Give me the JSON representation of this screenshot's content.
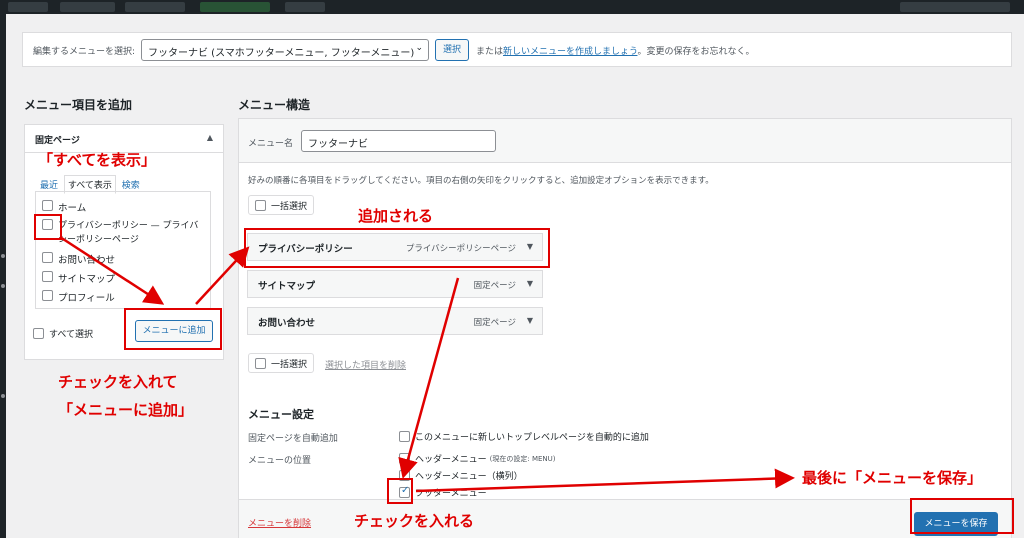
{
  "select_bar": {
    "label": "編集するメニューを選択:",
    "selected_menu": "フッターナビ (スマホフッターメニュー, フッターメニュー)",
    "select_button": "選択",
    "text_or": "または",
    "create_link": "新しいメニューを作成しましょう",
    "text_suffix": "。変更の保存をお忘れなく。"
  },
  "left": {
    "heading": "メニュー項目を追加",
    "panel_title": "固定ページ",
    "tabs": [
      "最近",
      "すべて表示",
      "検索"
    ],
    "pages": [
      "ホーム",
      "プライバシーポリシー — プライバシーポリシーページ",
      "お問い合わせ",
      "サイトマップ",
      "プロフィール"
    ],
    "select_all": "すべて選択",
    "add_button": "メニューに追加"
  },
  "right": {
    "heading": "メニュー構造",
    "name_label": "メニュー名",
    "name_value": "フッターナビ",
    "instructions": "好みの順番に各項目をドラッグしてください。項目の右側の矢印をクリックすると、追加設定オプションを表示できます。",
    "bulk_select": "一括選択",
    "items": [
      {
        "title": "プライバシーポリシー",
        "type": "プライバシーポリシーページ"
      },
      {
        "title": "サイトマップ",
        "type": "固定ページ"
      },
      {
        "title": "お問い合わせ",
        "type": "固定ページ"
      }
    ],
    "delete_selected": "選択した項目を削除",
    "settings_title": "メニュー設定",
    "auto_add_label": "固定ページを自動追加",
    "auto_add_option": "このメニューに新しいトップレベルページを自動的に追加",
    "position_label": "メニューの位置",
    "positions": [
      {
        "label": "ヘッダーメニュー",
        "note": "(現在の設定: MENU)",
        "checked": false
      },
      {
        "label": "ヘッダーメニュー（横列）",
        "note": "",
        "checked": false
      },
      {
        "label": "フッターメニュー",
        "note": "",
        "checked": true
      }
    ],
    "delete_menu": "メニューを削除",
    "save_button": "メニューを保存"
  },
  "annotations": {
    "show_all": "「すべてを表示」",
    "added": "追加される",
    "check_and_add_1": "チェックを入れて",
    "check_and_add_2": "「メニューに追加」",
    "check_it": "チェックを入れる",
    "finally_save": "最後に「メニューを保存」"
  },
  "colors": {
    "accent": "#2271b1",
    "annotation": "#e00000",
    "admin_bar": "#1d2327"
  }
}
